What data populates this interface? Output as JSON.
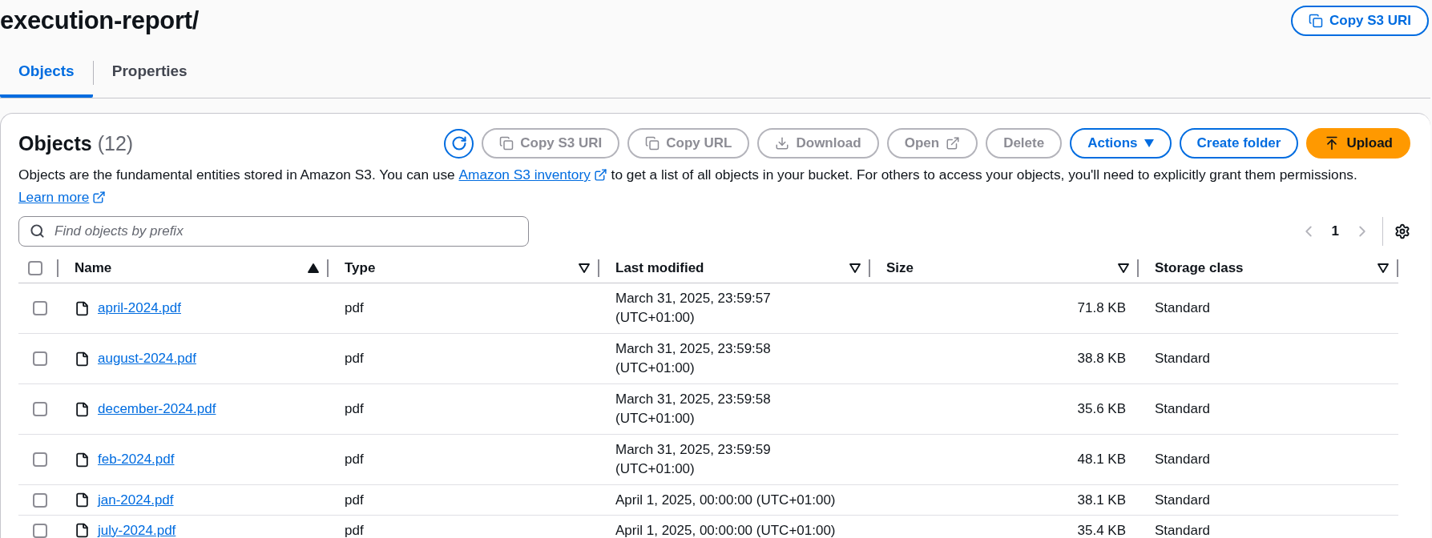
{
  "page": {
    "title": "execution-report/",
    "copy_button": "Copy S3 URI"
  },
  "tabs": [
    {
      "label": "Objects",
      "selected": true
    },
    {
      "label": "Properties",
      "selected": false
    }
  ],
  "panel": {
    "title": "Objects",
    "count": "(12)",
    "actions": [
      {
        "label": "Copy S3 URI",
        "kind": "copy",
        "disabled": true
      },
      {
        "label": "Copy URL",
        "kind": "copy",
        "disabled": true
      },
      {
        "label": "Download",
        "kind": "download",
        "disabled": true
      },
      {
        "label": "Open",
        "kind": "external",
        "disabled": true
      },
      {
        "label": "Delete",
        "kind": "plain",
        "disabled": true
      },
      {
        "label": "Actions",
        "kind": "dropdown",
        "disabled": false
      },
      {
        "label": "Create folder",
        "kind": "plain",
        "disabled": false
      },
      {
        "label": "Upload",
        "kind": "upload",
        "disabled": false
      }
    ],
    "description": {
      "before": "Objects are the fundamental entities stored in Amazon S3. You can use ",
      "link": "Amazon S3 inventory",
      "after": " to get a list of all objects in your bucket. For others to access your objects, you'll need to explicitly grant them permissions.",
      "learn_more": "Learn more"
    },
    "search": {
      "placeholder": "Find objects by prefix"
    },
    "pagination": {
      "page": "1"
    }
  },
  "table": {
    "select_all_checked": false,
    "columns": [
      {
        "label": "Name",
        "sorted": true
      },
      {
        "label": "Type",
        "sorted": false
      },
      {
        "label": "Last modified",
        "sorted": false
      },
      {
        "label": "Size",
        "sorted": false
      },
      {
        "label": "Storage class",
        "sorted": false
      }
    ],
    "rows": [
      {
        "checked": false,
        "name": "april-2024.pdf",
        "type": "pdf",
        "modified": "March 31, 2025, 23:59:57 (UTC+01:00)",
        "size": "71.8 KB",
        "storage": "Standard"
      },
      {
        "checked": false,
        "name": "august-2024.pdf",
        "type": "pdf",
        "modified": "March 31, 2025, 23:59:58 (UTC+01:00)",
        "size": "38.8 KB",
        "storage": "Standard"
      },
      {
        "checked": false,
        "name": "december-2024.pdf",
        "type": "pdf",
        "modified": "March 31, 2025, 23:59:58 (UTC+01:00)",
        "size": "35.6 KB",
        "storage": "Standard"
      },
      {
        "checked": false,
        "name": "feb-2024.pdf",
        "type": "pdf",
        "modified": "March 31, 2025, 23:59:59 (UTC+01:00)",
        "size": "48.1 KB",
        "storage": "Standard"
      },
      {
        "checked": false,
        "name": "jan-2024.pdf",
        "type": "pdf",
        "modified": "April 1, 2025, 00:00:00 (UTC+01:00)",
        "size": "38.1 KB",
        "storage": "Standard"
      },
      {
        "checked": false,
        "name": "july-2024.pdf",
        "type": "pdf",
        "modified": "April 1, 2025, 00:00:00 (UTC+01:00)",
        "size": "35.4 KB",
        "storage": "Standard"
      }
    ]
  }
}
